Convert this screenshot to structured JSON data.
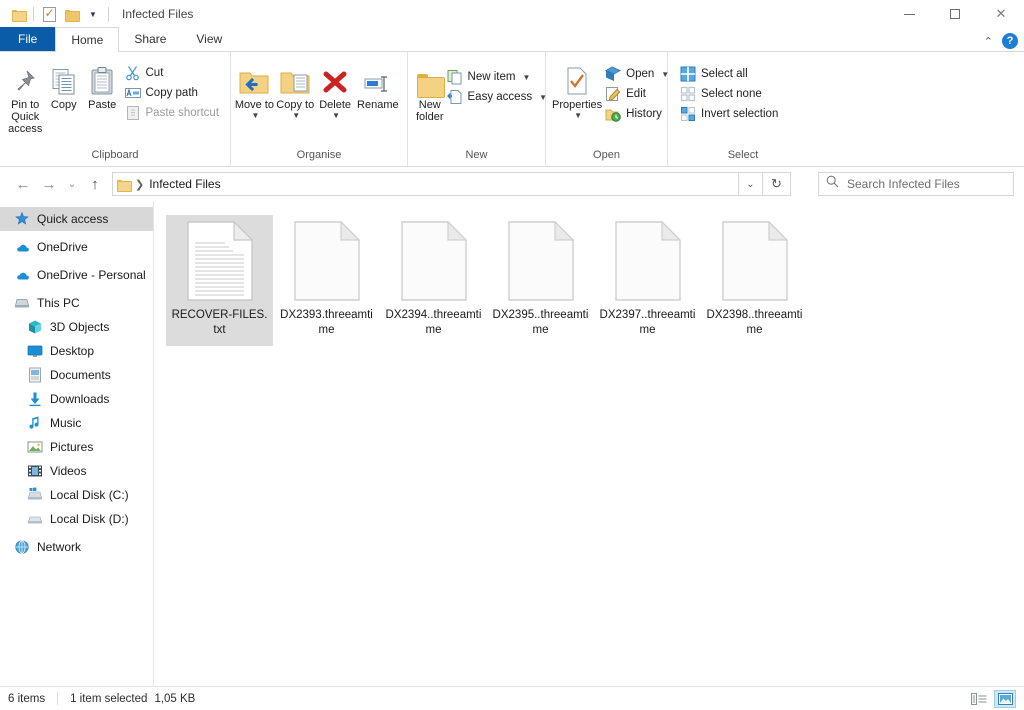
{
  "window": {
    "title": "Infected Files",
    "quick_access_icons": [
      "folder-icon",
      "properties-check-icon",
      "folder-icon",
      "chevron-down-icon"
    ],
    "controls": {
      "minimize": "minimize-icon",
      "maximize": "maximize-icon",
      "close": "close-icon"
    }
  },
  "tabs": [
    {
      "label": "File",
      "id": "file"
    },
    {
      "label": "Home",
      "id": "home"
    },
    {
      "label": "Share",
      "id": "share"
    },
    {
      "label": "View",
      "id": "view"
    }
  ],
  "tab_right": {
    "collapse": "chevron-up-icon",
    "help": "?"
  },
  "ribbon": {
    "groups": [
      {
        "title": "Clipboard",
        "big": [
          {
            "label": "Pin to Quick access",
            "icon": "pin-icon"
          },
          {
            "label": "Copy",
            "icon": "copy-icon"
          },
          {
            "label": "Paste",
            "icon": "paste-icon"
          }
        ],
        "small": [
          {
            "label": "Cut",
            "icon": "scissors-icon",
            "dim": false
          },
          {
            "label": "Copy path",
            "icon": "copy-path-icon",
            "dim": false
          },
          {
            "label": "Paste shortcut",
            "icon": "paste-shortcut-icon",
            "dim": true
          }
        ]
      },
      {
        "title": "Organise",
        "big": [
          {
            "label": "Move to",
            "icon": "move-to-icon",
            "caret": true
          },
          {
            "label": "Copy to",
            "icon": "copy-to-icon",
            "caret": true
          },
          {
            "label": "Delete",
            "icon": "delete-icon",
            "caret": true
          },
          {
            "label": "Rename",
            "icon": "rename-icon",
            "caret": false
          }
        ],
        "small": []
      },
      {
        "title": "New",
        "big": [
          {
            "label": "New folder",
            "icon": "new-folder-icon"
          }
        ],
        "small": [
          {
            "label": "New item",
            "icon": "new-item-icon",
            "caret": true
          },
          {
            "label": "Easy access",
            "icon": "easy-access-icon",
            "caret": true
          }
        ]
      },
      {
        "title": "Open",
        "big": [
          {
            "label": "Properties",
            "icon": "properties-icon",
            "caret": true
          }
        ],
        "small": [
          {
            "label": "Open",
            "icon": "open-icon",
            "caret": true
          },
          {
            "label": "Edit",
            "icon": "edit-icon",
            "caret": false
          },
          {
            "label": "History",
            "icon": "history-icon",
            "caret": false
          }
        ]
      },
      {
        "title": "Select",
        "big": [],
        "small": [
          {
            "label": "Select all",
            "icon": "select-all-icon"
          },
          {
            "label": "Select none",
            "icon": "select-none-icon"
          },
          {
            "label": "Invert selection",
            "icon": "invert-selection-icon"
          }
        ]
      }
    ]
  },
  "address": {
    "back": "back-arrow-icon",
    "forward": "forward-arrow-icon",
    "recent": "chevron-down-icon",
    "up": "up-arrow-icon",
    "crumb_icon": "folder-icon",
    "crumb": "Infected Files",
    "dropdown": "chevron-down-icon",
    "refresh": "refresh-icon"
  },
  "search": {
    "icon": "search-icon",
    "placeholder": "Search Infected Files",
    "value": ""
  },
  "sidebar": {
    "items": [
      {
        "label": "Quick access",
        "icon": "star-pin-icon",
        "selected": true,
        "indent": false
      },
      {
        "label": "OneDrive",
        "icon": "cloud-icon",
        "selected": false,
        "indent": false,
        "gap": true
      },
      {
        "label": "OneDrive - Personal",
        "icon": "cloud-icon",
        "selected": false,
        "indent": false,
        "gap": true
      },
      {
        "label": "This PC",
        "icon": "computer-icon",
        "selected": false,
        "indent": false,
        "gap": true
      },
      {
        "label": "3D Objects",
        "icon": "3d-objects-icon",
        "selected": false,
        "indent": true
      },
      {
        "label": "Desktop",
        "icon": "desktop-icon",
        "selected": false,
        "indent": true
      },
      {
        "label": "Documents",
        "icon": "documents-icon",
        "selected": false,
        "indent": true
      },
      {
        "label": "Downloads",
        "icon": "downloads-icon",
        "selected": false,
        "indent": true
      },
      {
        "label": "Music",
        "icon": "music-icon",
        "selected": false,
        "indent": true
      },
      {
        "label": "Pictures",
        "icon": "pictures-icon",
        "selected": false,
        "indent": true
      },
      {
        "label": "Videos",
        "icon": "videos-icon",
        "selected": false,
        "indent": true
      },
      {
        "label": "Local Disk (C:)",
        "icon": "disk-windows-icon",
        "selected": false,
        "indent": true
      },
      {
        "label": "Local Disk (D:)",
        "icon": "disk-icon",
        "selected": false,
        "indent": true
      },
      {
        "label": "Network",
        "icon": "network-icon",
        "selected": false,
        "indent": false,
        "gap": true
      }
    ]
  },
  "files": [
    {
      "name": "RECOVER-FILES.txt",
      "icon": "text-document-icon",
      "selected": true
    },
    {
      "name": "DX2393.threeamtime",
      "icon": "blank-document-icon",
      "selected": false
    },
    {
      "name": "DX2394..threeamtime",
      "icon": "blank-document-icon",
      "selected": false
    },
    {
      "name": "DX2395..threeamtime",
      "icon": "blank-document-icon",
      "selected": false
    },
    {
      "name": "DX2397..threeamtime",
      "icon": "blank-document-icon",
      "selected": false
    },
    {
      "name": "DX2398..threeamtime",
      "icon": "blank-document-icon",
      "selected": false
    }
  ],
  "status": {
    "item_count": "6 items",
    "selection": "1 item selected",
    "size": "1,05 KB",
    "views": [
      {
        "name": "details-view",
        "active": false
      },
      {
        "name": "large-icons-view",
        "active": true
      }
    ]
  },
  "colors": {
    "file_tab_blue": "#0b5ca8",
    "selection_gray": "#dcdcdc",
    "accent_blue": "#1b7fd4",
    "folder_yellow": "#f5d283"
  }
}
